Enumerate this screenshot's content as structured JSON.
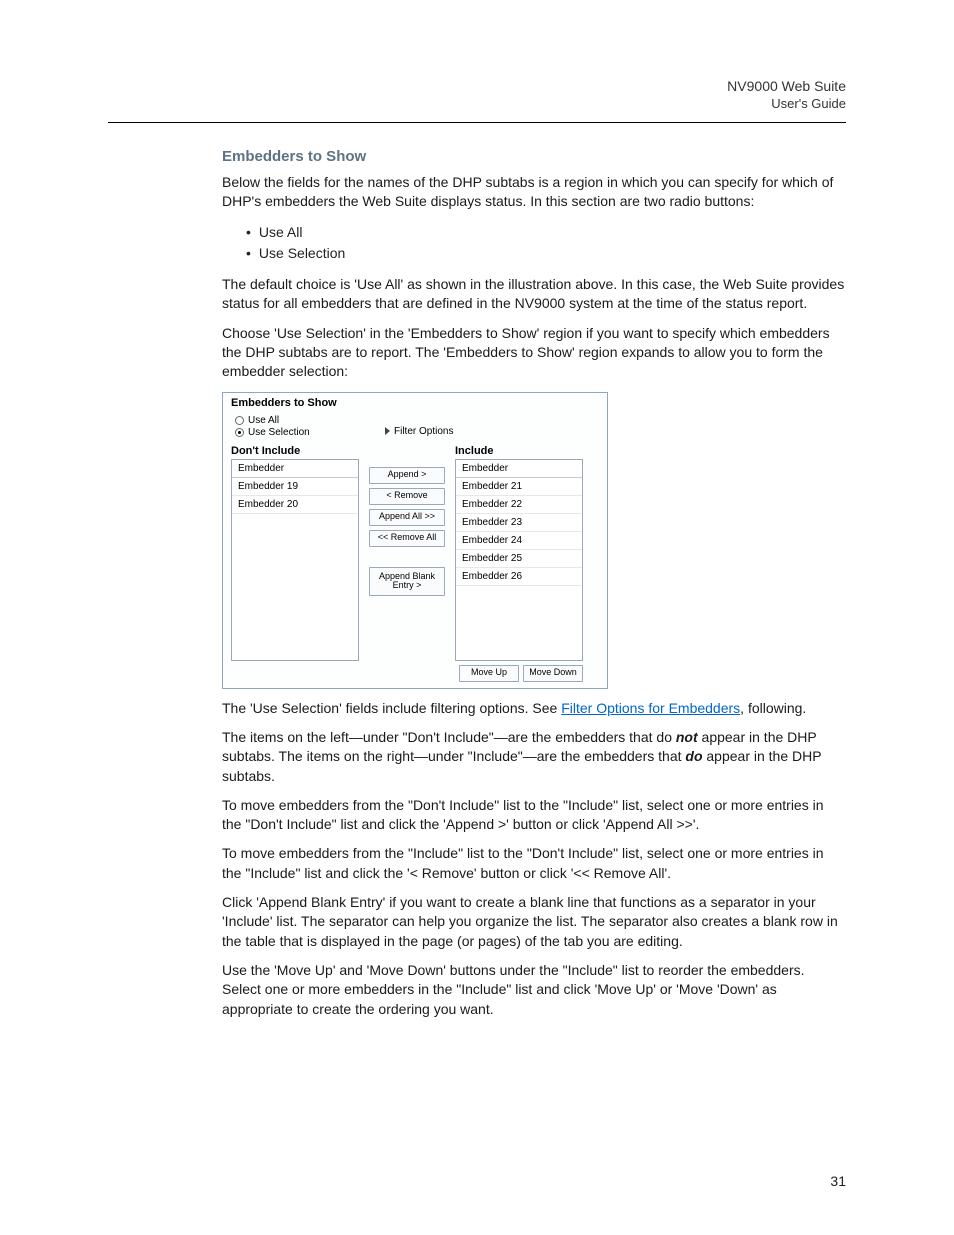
{
  "header": {
    "product": "NV9000 Web Suite",
    "subtitle": "User's Guide"
  },
  "section_title": "Embedders to Show",
  "p1": "Below the fields for the names of the DHP subtabs is a region in which you can specify for which of DHP's embedders the Web Suite displays status. In this section are two radio buttons:",
  "bullets": [
    "Use All",
    "Use Selection"
  ],
  "p2": "The default choice is 'Use All' as shown in the illustration above. In this case, the Web Suite provides status for all embedders that are defined in the NV9000 system at the time of the status report.",
  "p3": "Choose 'Use Selection' in the 'Embedders to Show' region if you want to specify which embedders the DHP subtabs are to report. The 'Embedders to Show' region expands to allow you to form the embedder selection:",
  "figure": {
    "title": "Embedders to Show",
    "radios": {
      "use_all": "Use All",
      "use_selection": "Use Selection"
    },
    "filter_label": "Filter Options",
    "left_label": "Don't Include",
    "right_label": "Include",
    "list_header": "Embedder",
    "left_items": [
      "Embedder 19",
      "Embedder 20"
    ],
    "right_items": [
      "Embedder 21",
      "Embedder 22",
      "Embedder 23",
      "Embedder 24",
      "Embedder 25",
      "Embedder 26"
    ],
    "buttons": {
      "append": "Append >",
      "remove": "< Remove",
      "append_all": "Append All >>",
      "remove_all": "<< Remove All",
      "append_blank": "Append Blank Entry >",
      "move_up": "Move Up",
      "move_down": "Move Down"
    }
  },
  "p4a": "The 'Use Selection' fields include filtering options. See ",
  "p4_link": "Filter Options for Embedders",
  "p4b": ", following.",
  "p5a": "The items on the left—under \"Don't Include\"—are the embedders that do ",
  "p5_bold1": "not",
  "p5b": " appear in the DHP subtabs. The items on the right—under \"Include\"—are the embedders that ",
  "p5_bold2": "do",
  "p5c": " appear in the DHP subtabs.",
  "p6": "To move embedders from the \"Don't Include\" list to the \"Include\" list, select one or more entries in the \"Don't Include\" list and click the 'Append >' button or click 'Append All >>'.",
  "p7": "To move embedders from the \"Include\" list to the \"Don't Include\" list, select one or more entries in the \"Include\" list and click the '< Remove' button or click '<< Remove All'.",
  "p8": "Click 'Append Blank Entry' if you want to create a blank line that functions as a separator in your 'Include' list. The separator can help you organize the list. The separator also creates a blank row in the table that is displayed in the page (or pages) of the tab you are editing.",
  "p9": "Use the 'Move Up' and 'Move Down' buttons under the \"Include\" list to reorder the embedders. Select one or more embedders in the \"Include\" list and click 'Move Up' or 'Move 'Down' as appropriate to create the ordering you want.",
  "page_number": "31"
}
